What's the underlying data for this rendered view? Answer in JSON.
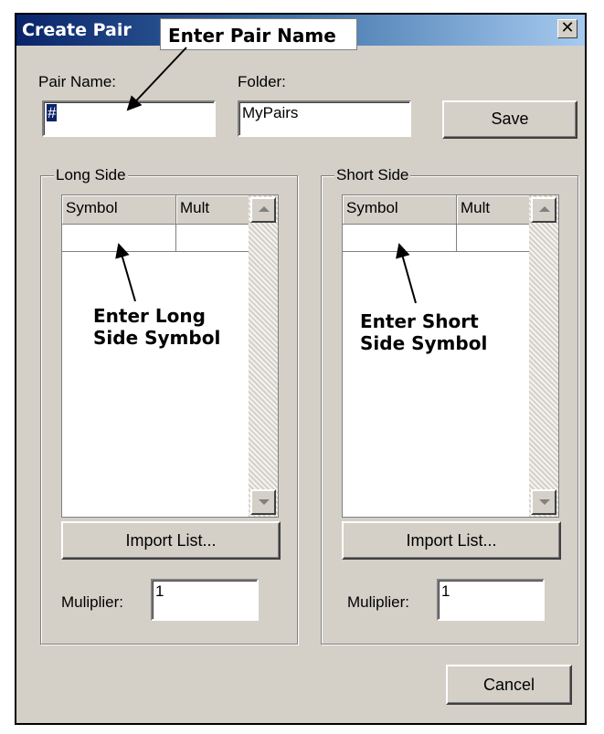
{
  "window": {
    "title": "Create Pair",
    "close_glyph": "✕"
  },
  "form": {
    "pair_name_label": "Pair Name:",
    "pair_name_value": "#",
    "folder_label": "Folder:",
    "folder_value": "MyPairs",
    "save_label": "Save",
    "cancel_label": "Cancel"
  },
  "long_side": {
    "title": "Long Side",
    "columns": [
      "Symbol",
      "Mult"
    ],
    "import_label": "Import List...",
    "multiplier_label": "Muliplier:",
    "multiplier_value": "1"
  },
  "short_side": {
    "title": "Short Side",
    "columns": [
      "Symbol",
      "Mult"
    ],
    "import_label": "Import List...",
    "multiplier_label": "Muliplier:",
    "multiplier_value": "1"
  },
  "annotations": {
    "pair_name_callout": "Enter Pair Name",
    "long_line1": "Enter Long",
    "long_line2": "Side Symbol",
    "short_line1": "Enter Short",
    "short_line2": "Side Symbol"
  },
  "icons": [
    "close-icon",
    "scroll-up-icon",
    "scroll-down-icon",
    "arrow-annotation-icon"
  ]
}
